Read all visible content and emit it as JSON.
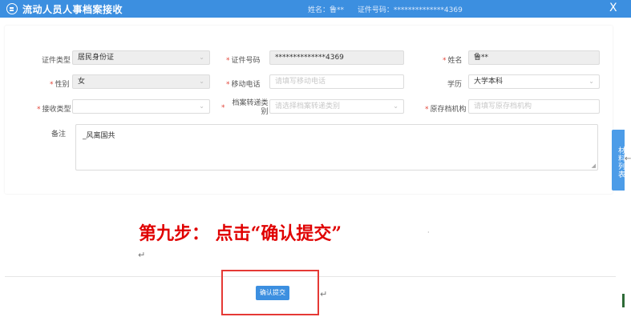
{
  "header": {
    "title": "流动人员人事档案接收",
    "name_label": "姓名：鲁**",
    "id_label": "证件号码：**************4369",
    "close": "X"
  },
  "form": {
    "id_type": {
      "label": "证件类型",
      "value": "居民身份证"
    },
    "id_number": {
      "label": "证件号码",
      "value": "**************4369"
    },
    "name": {
      "label": "姓名",
      "value": "鲁**"
    },
    "gender": {
      "label": "性别",
      "value": "女"
    },
    "mobile": {
      "label": "移动电话",
      "placeholder": "请填写移动电话"
    },
    "education": {
      "label": "学历",
      "value": "大学本科"
    },
    "receive_type": {
      "label": "接收类型",
      "value": ""
    },
    "transfer_type": {
      "label": "档案转递类别",
      "placeholder": "请选择档案转递类别"
    },
    "original_org": {
      "label": "原存档机构",
      "placeholder": "请填写原存档机构"
    },
    "remark": {
      "label": "备注",
      "value": "_风离国共"
    }
  },
  "side_tab": {
    "label": "材料列表"
  },
  "instruction": {
    "text": "第九步： 点击“确认提交”"
  },
  "footer": {
    "confirm_label": "确认提交"
  },
  "icons": {
    "dropdown": "chevron-down-icon",
    "app": "list-circle-icon",
    "paragraph": "return-arrow-icon"
  },
  "colors": {
    "header": "#3c8fe0",
    "instruction": "#e00000",
    "highlight": "#e53935",
    "required": "#e2463a"
  }
}
